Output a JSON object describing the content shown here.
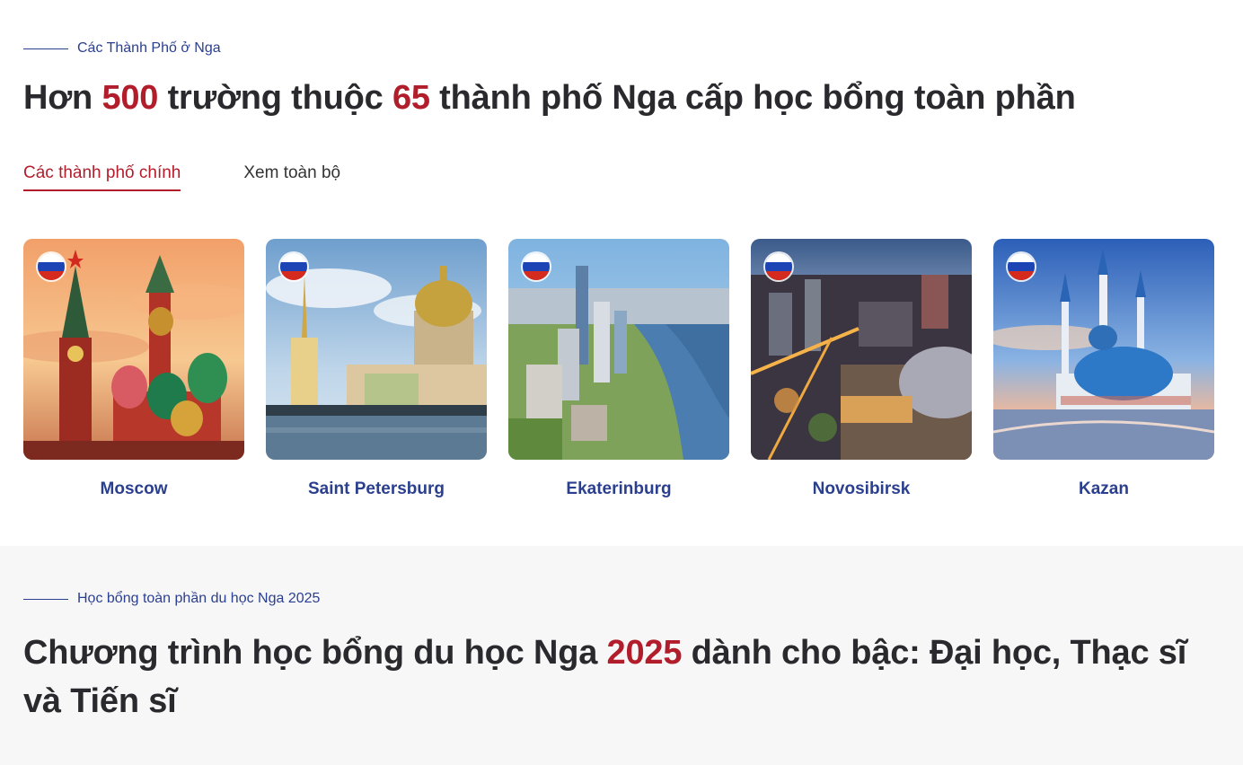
{
  "cities_section": {
    "eyebrow": "Các Thành Phố ở Nga",
    "headline": {
      "part1": "Hơn ",
      "num1": "500",
      "part2": " trường thuộc ",
      "num2": "65",
      "part3": " thành phố Nga cấp học bổng toàn phần"
    },
    "tabs": [
      {
        "label": "Các thành phố chính",
        "active": true
      },
      {
        "label": "Xem toàn bộ",
        "active": false
      }
    ],
    "cities": [
      {
        "name": "Moscow",
        "flag_icon": "russia-flag-icon"
      },
      {
        "name": "Saint Petersburg",
        "flag_icon": "russia-flag-icon"
      },
      {
        "name": "Ekaterinburg",
        "flag_icon": "russia-flag-icon"
      },
      {
        "name": "Novosibirsk",
        "flag_icon": "russia-flag-icon"
      },
      {
        "name": "Kazan",
        "flag_icon": "russia-flag-icon"
      }
    ]
  },
  "scholarship_section": {
    "eyebrow": "Học bổng toàn phần du học Nga 2025",
    "headline": {
      "part1": "Chương trình học bổng du học Nga ",
      "year": "2025",
      "part2": " dành cho bậc: Đại học, Thạc sĩ",
      "line2": "và Tiến sĩ"
    }
  },
  "colors": {
    "accent_red": "#b21d2b",
    "brand_blue": "#2b3f8f",
    "heading": "#2a2a2e",
    "section_bg": "#f7f7f8"
  }
}
